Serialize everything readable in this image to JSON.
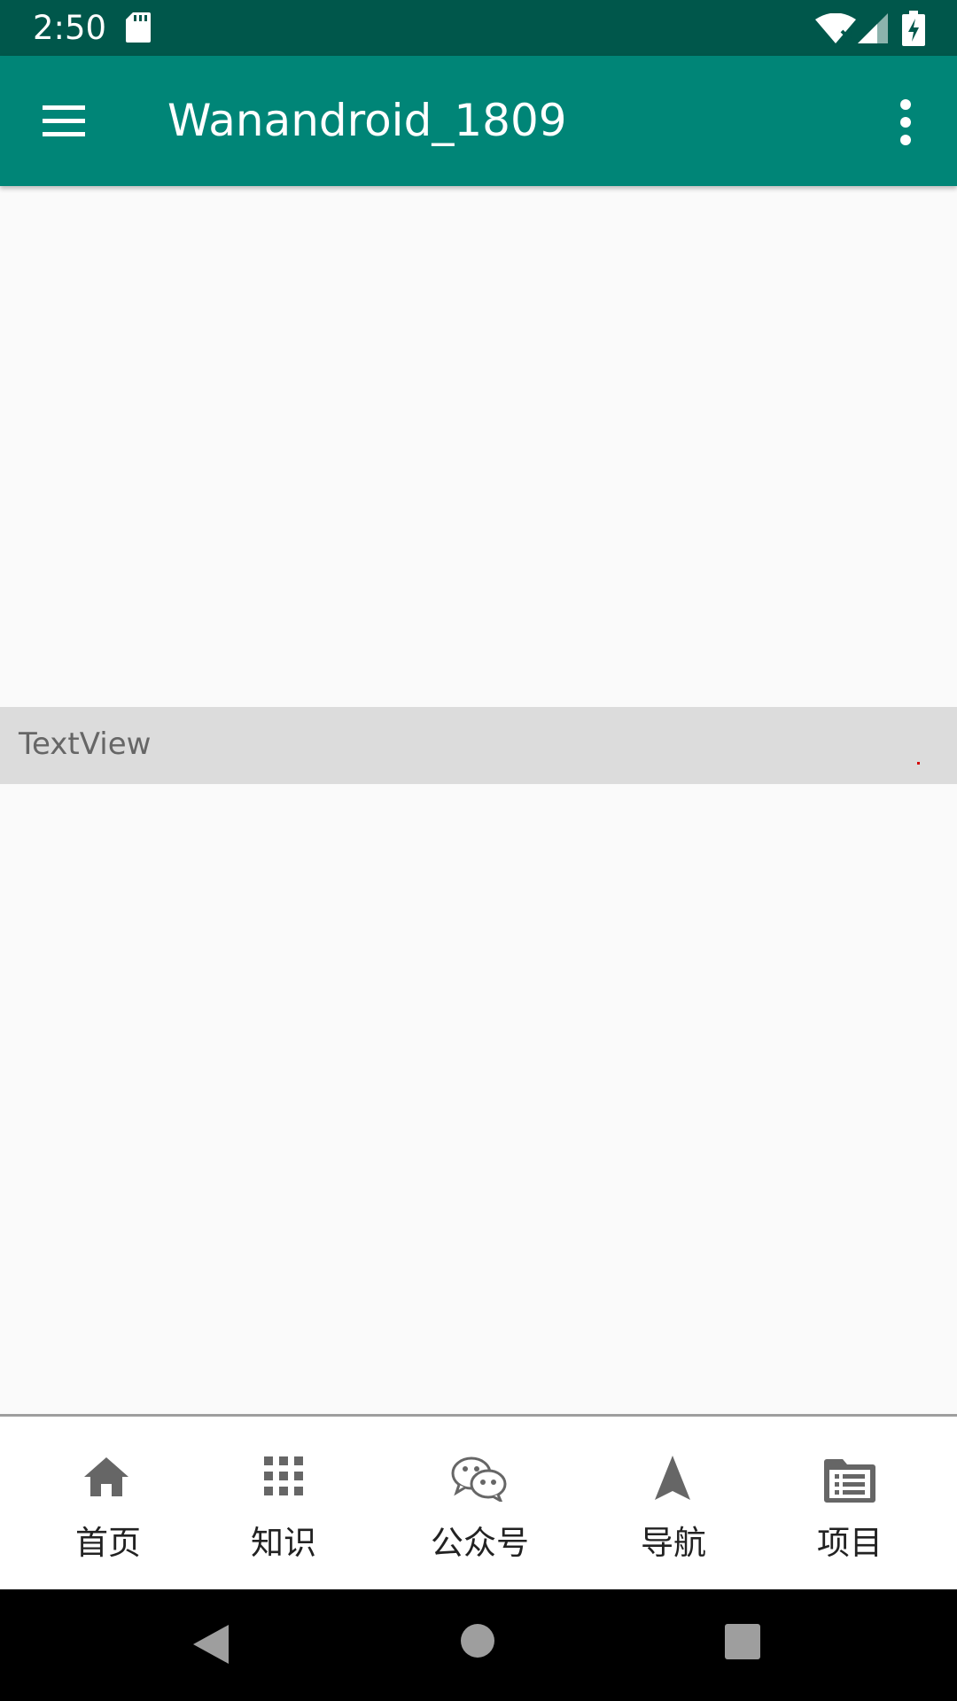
{
  "status_bar": {
    "time": "2:50",
    "icons": [
      "sd-card-icon",
      "wifi-icon",
      "signal-icon",
      "battery-charging-icon"
    ]
  },
  "toolbar": {
    "title": "Wanandroid_1809",
    "menu_icon": "hamburger-menu-icon",
    "overflow_icon": "more-vert-icon",
    "color": "#008577"
  },
  "content": {
    "textview_label": "TextView"
  },
  "bottom_nav": {
    "items": [
      {
        "label": "首页",
        "icon": "home-icon"
      },
      {
        "label": "知识",
        "icon": "grid-icon"
      },
      {
        "label": "公众号",
        "icon": "wechat-icon"
      },
      {
        "label": "导航",
        "icon": "navigation-icon"
      },
      {
        "label": "项目",
        "icon": "folder-list-icon"
      }
    ]
  },
  "system_nav": {
    "buttons": [
      "back-icon",
      "home-circle-icon",
      "recents-icon"
    ]
  },
  "colors": {
    "status_bar": "#00574b",
    "primary": "#008577",
    "textview_background": "#dcdcdc",
    "icon_gray": "#666666"
  }
}
